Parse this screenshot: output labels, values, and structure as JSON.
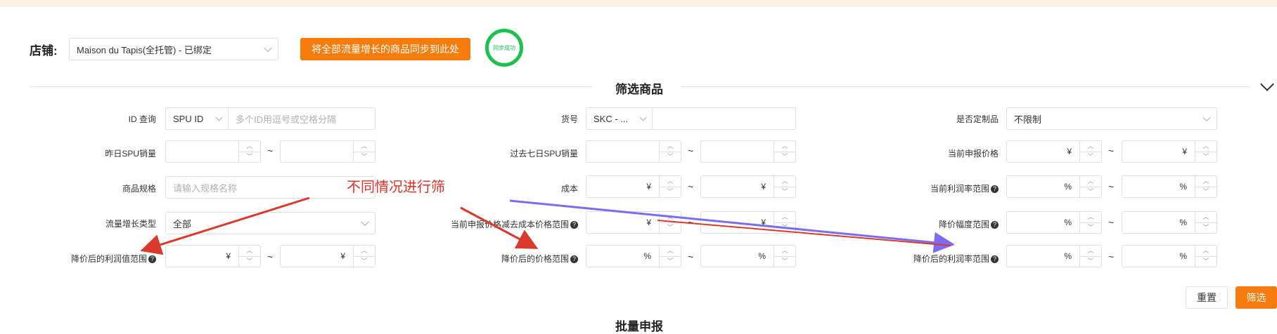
{
  "header": {
    "store_label": "店铺:",
    "store_value": "Maison du Tapis(全托管) - 已绑定",
    "sync_button": "将全部流量增长的商品同步到此处",
    "sync_status": "同步成功"
  },
  "filter": {
    "title": "筛选商品",
    "col1": {
      "id_label": "ID 查询",
      "id_type": "SPU ID",
      "id_placeholder": "多个ID用逗号或空格分隔",
      "yesterday_sales_label": "昨日SPU销量",
      "spec_label": "商品规格",
      "spec_placeholder": "请输入规格名称",
      "growth_type_label": "流量增长类型",
      "growth_type_value": "全部",
      "profit_after_label": "降价后的利润值范围",
      "currency_unit": "¥"
    },
    "col2": {
      "sku_label": "货号",
      "sku_type": "SKC - ...",
      "last7_sales_label": "过去七日SPU销量",
      "cost_label": "成本",
      "declared_vs_cost_label": "当前申报价格减去成本价格范围",
      "price_after_label": "降价后的价格范围",
      "currency_unit": "¥",
      "percent_unit": "%"
    },
    "col3": {
      "custom_label": "是否定制品",
      "custom_value": "不限制",
      "declared_price_label": "当前申报价格",
      "profit_rate_label": "当前利润率范围",
      "reduce_range_label": "降价幅度范围",
      "profit_rate_after_label": "降价后的利润率范围",
      "currency_unit": "¥",
      "percent_unit": "%"
    },
    "tilde": "~",
    "reset_button": "重置",
    "filter_button": "筛选"
  },
  "next_section_title": "批量申报",
  "annotation": {
    "text": "不同情况进行筛",
    "colors": {
      "red": "#e0312b",
      "purple": "#7b6cf5"
    }
  }
}
